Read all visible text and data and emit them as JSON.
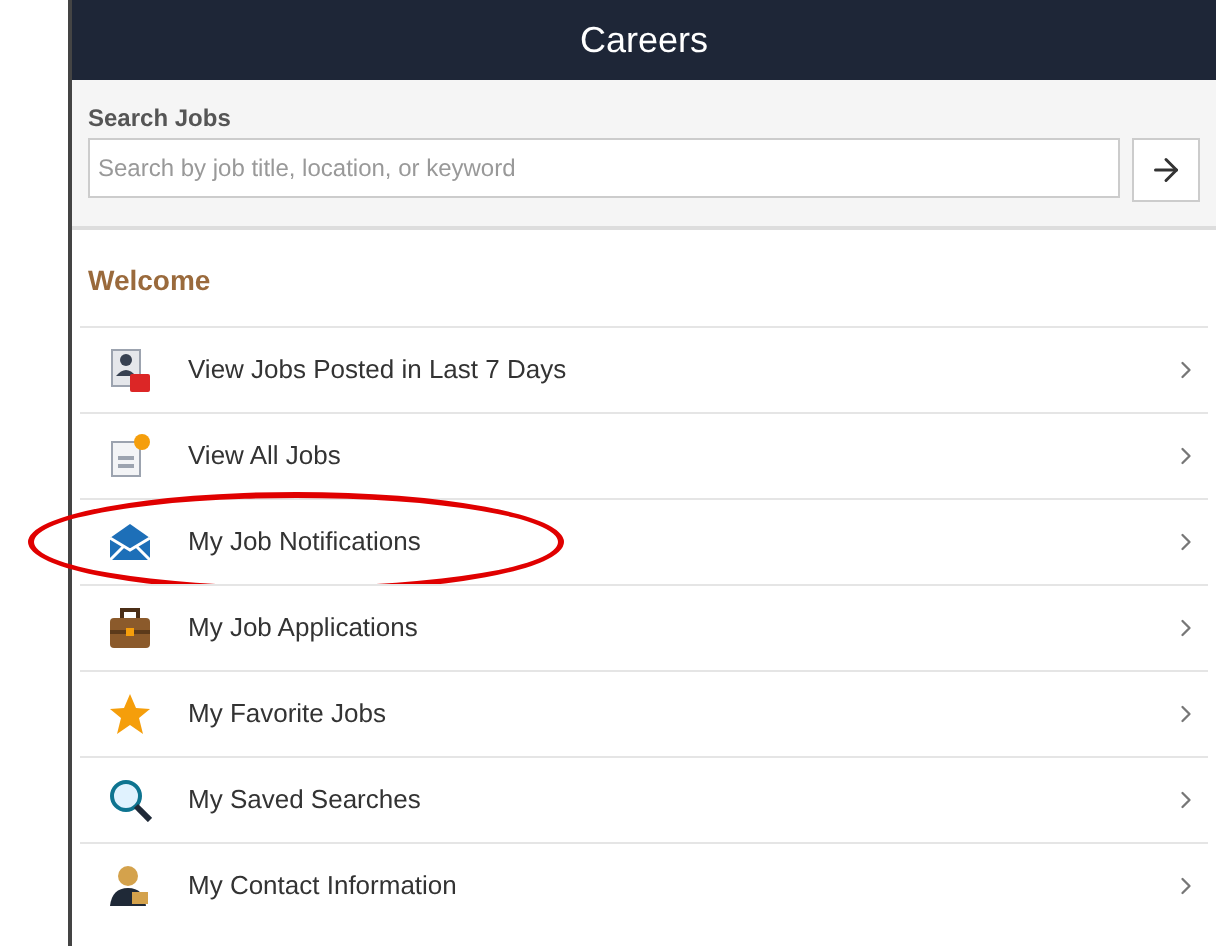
{
  "header": {
    "title": "Careers"
  },
  "search": {
    "label": "Search Jobs",
    "placeholder": "Search by job title, location, or keyword"
  },
  "section": {
    "title": "Welcome"
  },
  "menu_items": [
    {
      "label": "View Jobs Posted in Last 7 Days",
      "kind": "recent",
      "circled": false
    },
    {
      "label": "View All Jobs",
      "kind": "all",
      "circled": false
    },
    {
      "label": "My Job Notifications",
      "kind": "mail",
      "circled": true
    },
    {
      "label": "My Job Applications",
      "kind": "briefcase",
      "circled": false
    },
    {
      "label": "My Favorite Jobs",
      "kind": "star",
      "circled": false
    },
    {
      "label": "My Saved Searches",
      "kind": "search",
      "circled": false
    },
    {
      "label": "My Contact Information",
      "kind": "contact",
      "circled": false
    }
  ]
}
